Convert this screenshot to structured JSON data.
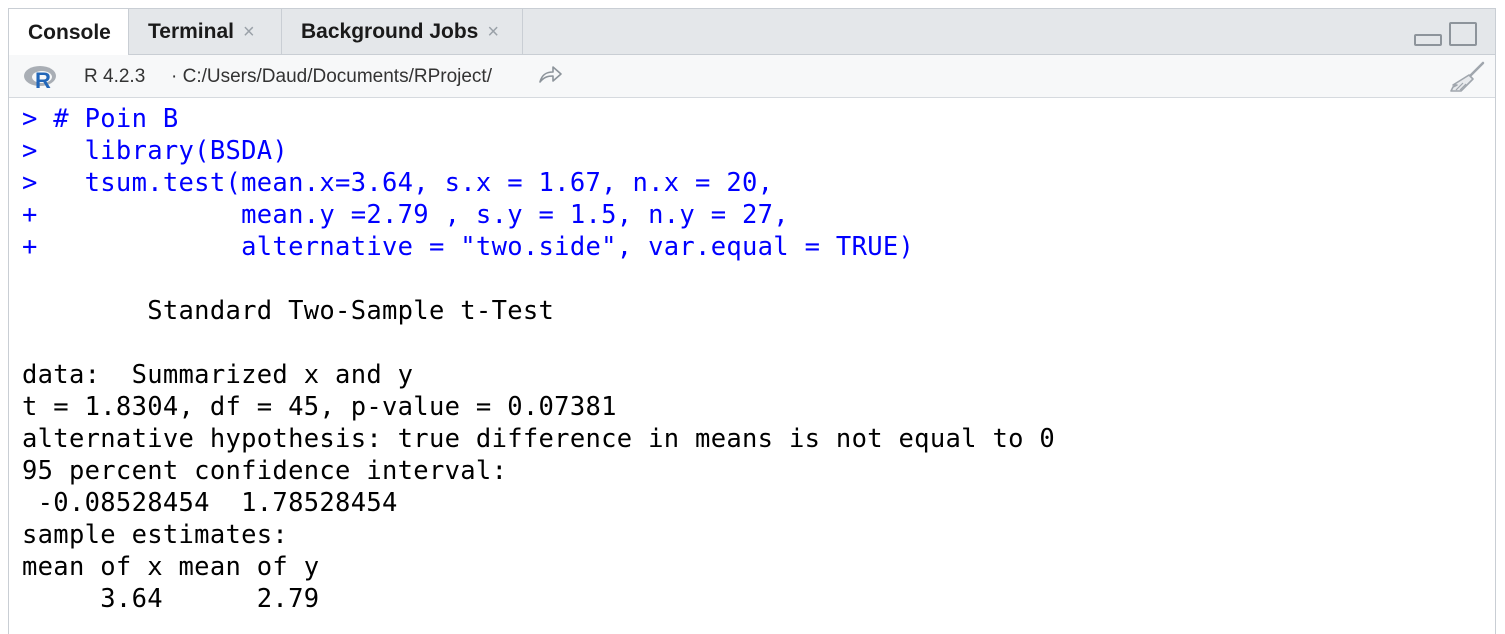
{
  "tabs": [
    {
      "label": "Console",
      "active": true
    },
    {
      "label": "Terminal",
      "close": "×"
    },
    {
      "label": "Background Jobs",
      "close": "×"
    }
  ],
  "infobar": {
    "r_version": "R 4.2.3",
    "path": "· C:/Users/Daud/Documents/RProject/"
  },
  "console": {
    "input_lines": [
      "> # Poin B",
      ">   library(BSDA)",
      ">   tsum.test(mean.x=3.64, s.x = 1.67, n.x = 20,",
      "+             mean.y =2.79 , s.y = 1.5, n.y = 27,",
      "+             alternative = \"two.side\", var.equal = TRUE)"
    ],
    "output_title": "        Standard Two-Sample t-Test",
    "output_lines": [
      "data:  Summarized x and y",
      "t = 1.8304, df = 45, p-value = 0.07381",
      "alternative hypothesis: true difference in means is not equal to 0",
      "95 percent confidence interval:",
      " -0.08528454  1.78528454",
      "sample estimates:",
      "mean of x mean of y",
      "     3.64      2.79"
    ]
  },
  "colors": {
    "input_text": "#0000ff",
    "output_text": "#000000",
    "tabbar_bg": "#e4e7ea",
    "r_logo_blue": "#2266b8"
  },
  "icons": {
    "r_logo": "r-logo-icon",
    "goto_dir": "go-to-directory-icon",
    "clear_console": "broom-icon",
    "minimize": "minimize-icon",
    "maximize": "maximize-icon"
  }
}
